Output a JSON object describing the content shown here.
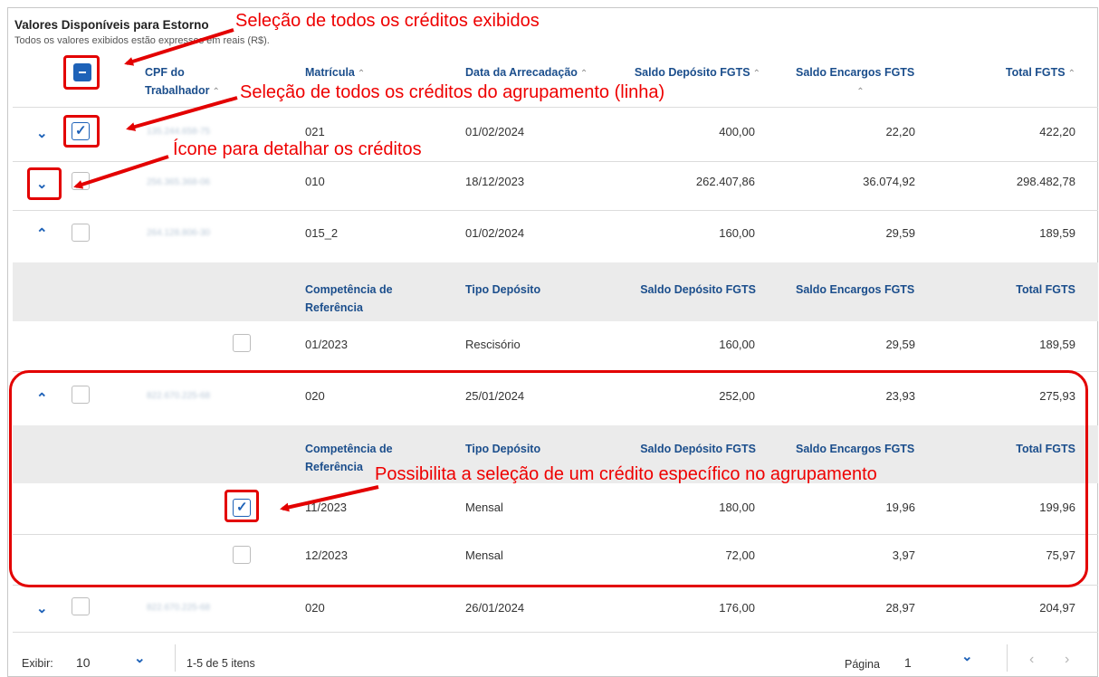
{
  "panel": {
    "title": "Valores Disponíveis para Estorno",
    "subtitle": "Todos os valores exibidos estão expressos em reais (R$)."
  },
  "main_headers": {
    "cpf_line1": "CPF do",
    "cpf_line2": "Trabalhador",
    "matricula": "Matrícula",
    "data": "Data da Arrecadação",
    "saldo_deposito": "Saldo Depósito FGTS",
    "saldo_encargos": "Saldo Encargos FGTS",
    "total": "Total FGTS",
    "sort_glyph": "⌃"
  },
  "sub_headers": {
    "competencia_line1": "Competência de",
    "competencia_line2": "Referência",
    "tipo": "Tipo Depósito",
    "saldo_deposito": "Saldo Depósito FGTS",
    "saldo_encargos": "Saldo Encargos FGTS",
    "total": "Total FGTS"
  },
  "rows": [
    {
      "cpf": "135.244.658-75",
      "matricula": "021",
      "data": "01/02/2024",
      "saldo_deposito": "400,00",
      "saldo_encargos": "22,20",
      "total": "422,20",
      "expanded": false,
      "checked": true
    },
    {
      "cpf": "256.365.368-06",
      "matricula": "010",
      "data": "18/12/2023",
      "saldo_deposito": "262.407,86",
      "saldo_encargos": "36.074,92",
      "total": "298.482,78",
      "expanded": false,
      "checked": false
    },
    {
      "cpf": "264.128.806-30",
      "matricula": "015_2",
      "data": "01/02/2024",
      "saldo_deposito": "160,00",
      "saldo_encargos": "29,59",
      "total": "189,59",
      "expanded": true,
      "checked": false
    },
    {
      "cpf": "822.670.225-68",
      "matricula": "020",
      "data": "25/01/2024",
      "saldo_deposito": "252,00",
      "saldo_encargos": "23,93",
      "total": "275,93",
      "expanded": true,
      "checked": false
    },
    {
      "cpf": "822.670.225-68",
      "matricula": "020",
      "data": "26/01/2024",
      "saldo_deposito": "176,00",
      "saldo_encargos": "28,97",
      "total": "204,97",
      "expanded": false,
      "checked": false
    }
  ],
  "detail_groups": [
    {
      "rows": [
        {
          "competencia": "01/2023",
          "tipo": "Rescisório",
          "saldo_deposito": "160,00",
          "saldo_encargos": "29,59",
          "total": "189,59",
          "checked": false
        }
      ]
    },
    {
      "rows": [
        {
          "competencia": "11/2023",
          "tipo": "Mensal",
          "saldo_deposito": "180,00",
          "saldo_encargos": "19,96",
          "total": "199,96",
          "checked": true
        },
        {
          "competencia": "12/2023",
          "tipo": "Mensal",
          "saldo_deposito": "72,00",
          "saldo_encargos": "3,97",
          "total": "75,97",
          "checked": false
        }
      ]
    }
  ],
  "footer": {
    "exibir_label": "Exibir:",
    "page_size": "10",
    "range_text": "1-5 de 5 itens",
    "pagina_label": "Página",
    "page_number": "1"
  },
  "annotations": {
    "select_all": "Seleção de todos os créditos exibidos",
    "select_group": "Seleção de todos os créditos do agrupamento (linha)",
    "detail_icon": "Ícone para detalhar os créditos",
    "select_specific": "Possibilita a seleção de um crédito específico no agrupamento"
  },
  "icons": {
    "chevron_down": "chevron-down-icon",
    "chevron_up": "chevron-up-icon",
    "check": "check-icon",
    "minus": "minus-icon",
    "prev": "chevron-left-icon",
    "next": "chevron-right-icon"
  },
  "colors": {
    "accent": "#1e62b8",
    "annotation_red": "#e30000",
    "sub_header_bg": "#ebebeb"
  }
}
